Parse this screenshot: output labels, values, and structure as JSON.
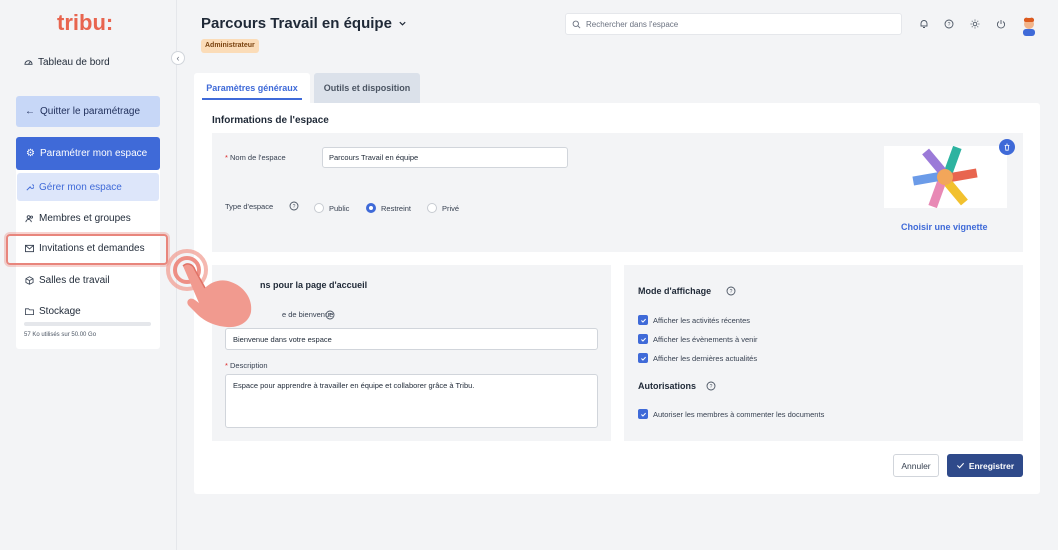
{
  "sidebar": {
    "logo_text": "tribu:",
    "dashboard": "Tableau de bord",
    "quit": "Quitter le paramétrage",
    "configure": "Paramétrer mon espace",
    "items": [
      {
        "label": "Gérer mon espace",
        "icon": "wrench-icon"
      },
      {
        "label": "Membres et groupes",
        "icon": "users-icon"
      },
      {
        "label": "Invitations et demandes",
        "icon": "mail-icon"
      },
      {
        "label": "Salles de travail",
        "icon": "cube-icon"
      },
      {
        "label": "Stockage",
        "icon": "folder-icon"
      }
    ],
    "storage_text": "57 Ko utilisés sur 50.00 Go"
  },
  "header": {
    "title": "Parcours Travail en équipe",
    "role_badge": "Administrateur",
    "search_placeholder": "Rechercher dans l'espace"
  },
  "tabs": [
    {
      "label": "Paramètres généraux",
      "active": true
    },
    {
      "label": "Outils et disposition",
      "active": false
    }
  ],
  "info": {
    "title": "Informations de l'espace",
    "name_label": "Nom de l'espace",
    "name_value": "Parcours Travail en équipe",
    "type_label": "Type d'espace",
    "types": [
      "Public",
      "Restreint",
      "Privé"
    ],
    "selected_type": "Restreint",
    "choose_thumb": "Choisir une vignette"
  },
  "home": {
    "title_visible": "ns pour la page d'accueil",
    "welcome_label_visible": "e de bienvenue",
    "welcome_value": "Bienvenue dans votre espace",
    "description_label": "Description",
    "description_value": "Espace pour apprendre à travailler en équipe et collaborer grâce à Tribu."
  },
  "display": {
    "title": "Mode d'affichage",
    "options": [
      "Afficher les activités récentes",
      "Afficher les évènements à venir",
      "Afficher les dernières actualités"
    ],
    "auth_title": "Autorisations",
    "auth_options": [
      "Autoriser les membres à commenter les documents"
    ]
  },
  "actions": {
    "cancel": "Annuler",
    "save": "Enregistrer"
  },
  "colors": {
    "primary": "#3f6ad8",
    "highlight": "#e8857c",
    "dark_button": "#2f4a8a"
  }
}
